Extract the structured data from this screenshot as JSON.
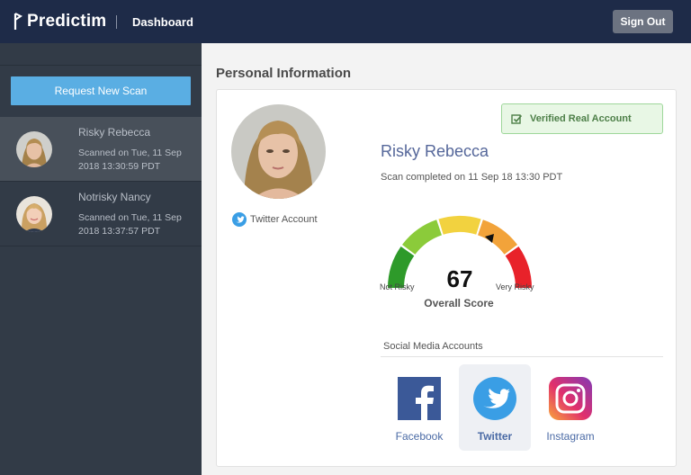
{
  "header": {
    "brand": "Predictim",
    "page": "Dashboard",
    "sign_out_label": "Sign Out"
  },
  "sidebar": {
    "request_button_label": "Request New Scan",
    "scans": [
      {
        "name": "Risky Rebecca",
        "meta": "Scanned on Tue, 11 Sep 2018 13:30:59 PDT",
        "active": true
      },
      {
        "name": "Notrisky Nancy",
        "meta": "Scanned on Tue, 11 Sep 2018 13:37:57 PDT",
        "active": false
      }
    ]
  },
  "main": {
    "section_title": "Personal Information",
    "profile": {
      "twitter_account_label": "Twitter Account",
      "verified_label": "Verified Real Account",
      "name": "Risky Rebecca",
      "scan_completed": "Scan completed on 11 Sep 18 13:30 PDT"
    },
    "score": {
      "value": "67",
      "min_label": "Not Risky",
      "max_label": "Very Risky",
      "caption": "Overall Score"
    },
    "social": {
      "title": "Social Media Accounts",
      "accounts": [
        {
          "label": "Facebook",
          "icon": "facebook-icon",
          "selected": false
        },
        {
          "label": "Twitter",
          "icon": "twitter-icon",
          "selected": true
        },
        {
          "label": "Instagram",
          "icon": "instagram-icon",
          "selected": false
        }
      ]
    }
  },
  "colors": {
    "topbar": "#1e2b48",
    "sidebar": "#323b47",
    "accent": "#5aaee3",
    "gauge_segments": [
      "#2e9a2a",
      "#8bcb3a",
      "#f2d23f",
      "#f2a33a",
      "#e8222a"
    ]
  }
}
